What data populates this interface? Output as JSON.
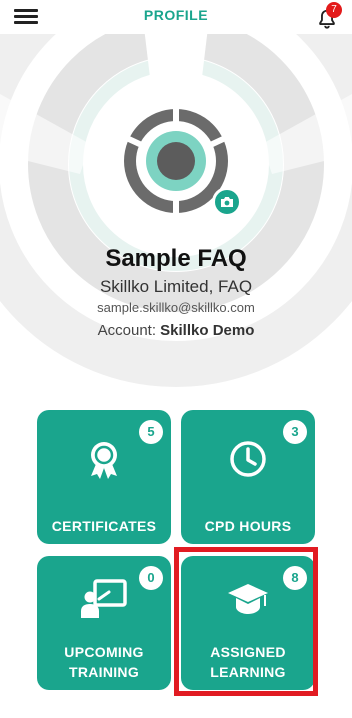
{
  "header": {
    "title": "PROFILE",
    "notification_count": "7"
  },
  "profile": {
    "name": "Sample FAQ",
    "company": "Skillko Limited, FAQ",
    "email": "sample.skillko@skillko.com",
    "account_label": "Account:",
    "account_value": "Skillko Demo"
  },
  "tiles": [
    {
      "label": "CERTIFICATES",
      "count": "5",
      "icon": "award-ribbon-icon"
    },
    {
      "label": "CPD HOURS",
      "count": "3",
      "icon": "clock-icon"
    },
    {
      "label_line1": "UPCOMING",
      "label_line2": "TRAINING",
      "count": "0",
      "icon": "presentation-icon"
    },
    {
      "label_line1": "ASSIGNED",
      "label_line2": "LEARNING",
      "count": "8",
      "icon": "graduation-cap-icon"
    }
  ],
  "colors": {
    "accent": "#1aa58d",
    "highlight": "#e11b22",
    "badge": "#e31b1b"
  }
}
